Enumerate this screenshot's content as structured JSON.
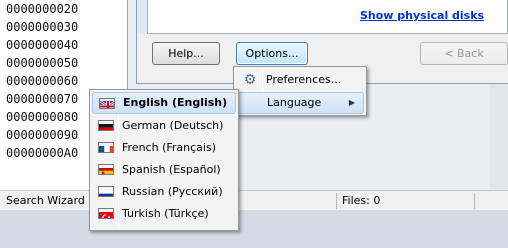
{
  "hex_pane": {
    "lines": [
      "0000000020",
      "0000000030",
      "0000000040",
      "0000000050",
      "0000000060",
      "0000000070",
      "0000000080",
      "0000000090",
      "00000000A0"
    ]
  },
  "dialog": {
    "link_label": "Show physical disks",
    "buttons": {
      "help": "Help...",
      "options": "Options...",
      "back": "< Back"
    }
  },
  "status_bar": {
    "left_text": "Search Wizard i",
    "files_text": "Files: 0"
  },
  "options_menu": {
    "items": [
      {
        "label": "Preferences...",
        "icon": "gear-icon"
      },
      {
        "label": "Language",
        "icon": ""
      }
    ]
  },
  "language_menu": {
    "items": [
      {
        "label": "English (English)",
        "flag": "uk-flag-icon",
        "selected": true
      },
      {
        "label": "German (Deutsch)",
        "flag": "germany-flag-icon",
        "selected": false
      },
      {
        "label": "French (Français)",
        "flag": "france-flag-icon",
        "selected": false
      },
      {
        "label": "Spanish (Español)",
        "flag": "spain-flag-icon",
        "selected": false
      },
      {
        "label": "Russian (Русский)",
        "flag": "russia-flag-icon",
        "selected": false
      },
      {
        "label": "Turkish (Türkçe)",
        "flag": "turkey-flag-icon",
        "selected": false
      }
    ]
  },
  "colors": {
    "link": "#0033cc",
    "menu_highlight": "#cde2f7"
  }
}
